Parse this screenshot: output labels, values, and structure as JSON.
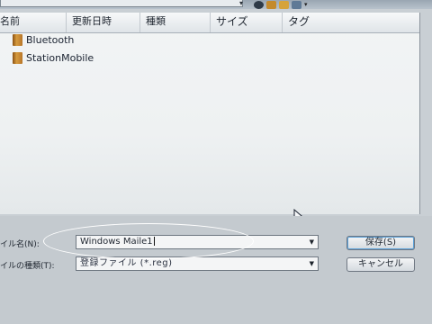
{
  "toolbar": {
    "icons": [
      "back-icon",
      "up-folder-icon",
      "new-folder-icon",
      "view-icon"
    ],
    "view_caret": "▾",
    "crumb_arrow": "▾"
  },
  "columns": [
    "名前",
    "更新日時",
    "種類",
    "サイズ",
    "タグ"
  ],
  "files": [
    {
      "name": "Bluetooth",
      "icon": "folder-icon"
    },
    {
      "name": "StationMobile",
      "icon": "folder-icon"
    }
  ],
  "form": {
    "filename_label": "イル名(N):",
    "filename_value": "Windows Maile1",
    "filetype_label": "イルの種類(T):",
    "filetype_value": "登録ファイル (*.reg)"
  },
  "buttons": {
    "save": "保存(S)",
    "cancel": "キャンセル"
  },
  "colors": {
    "pane": "#eef1f2",
    "footer": "#c4cacf",
    "highlight_ellipse": "#ffffff"
  }
}
